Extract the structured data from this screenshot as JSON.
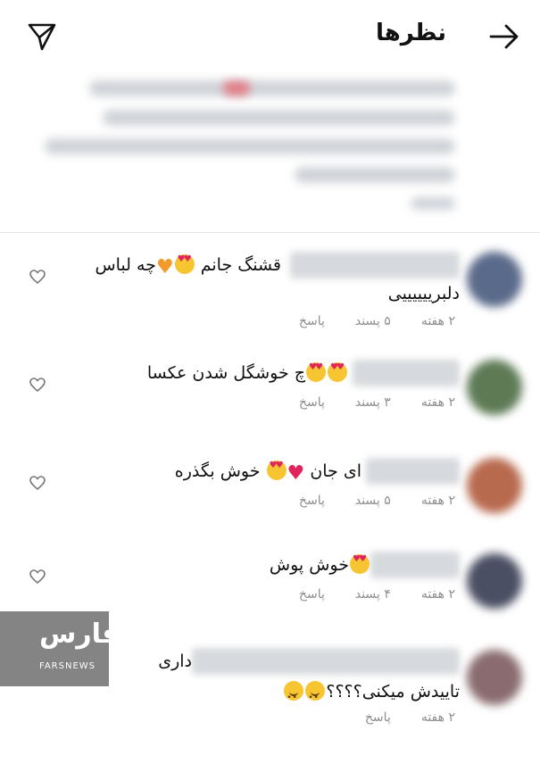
{
  "header": {
    "title": "نظرها",
    "back_icon": "arrow-right-icon",
    "send_icon": "paper-plane-icon"
  },
  "comments": [
    {
      "line1": "قشنگ جانم",
      "line1_suffix": "چه لباس",
      "line2": "دلبرییییییی",
      "time": "۲ هفته",
      "likes": "۵ پسند",
      "reply": "پاسخ"
    },
    {
      "line1": "چ خوشگل شدن عکسا",
      "time": "۲ هفته",
      "likes": "۳ پسند",
      "reply": "پاسخ"
    },
    {
      "line1": "ای جان",
      "line1_suffix": "خوش بگذره",
      "time": "۲ هفته",
      "likes": "۵ پسند",
      "reply": "پاسخ"
    },
    {
      "line1": "خوش پوش",
      "time": "۲ هفته",
      "likes": "۴ پسند",
      "reply": "پاسخ"
    },
    {
      "line1": "داری",
      "line2": "تاییدش میکنی؟؟؟؟",
      "time": "۲ هفته",
      "reply": "پاسخ"
    }
  ],
  "watermark": {
    "logo": "فارس",
    "text": "FARSNEWS"
  },
  "colors": {
    "meta_gray": "#8e8e8e",
    "heart_red": "#e0245e",
    "emoji_yellow": "#f7c531"
  }
}
